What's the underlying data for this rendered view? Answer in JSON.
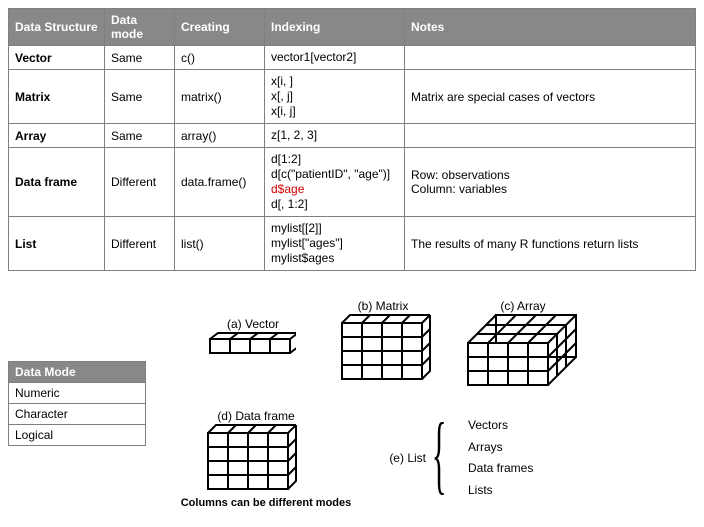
{
  "table": {
    "headers": [
      "Data Structure",
      "Data mode",
      "Creating",
      "Indexing",
      "Notes"
    ],
    "rows": [
      {
        "structure": "Vector",
        "mode": "Same",
        "creating": "c()",
        "indexing": [
          "vector1[vector2]"
        ],
        "notes": ""
      },
      {
        "structure": "Matrix",
        "mode": "Same",
        "creating": "matrix()",
        "indexing": [
          "x[i, ]",
          "x[, j]",
          "x[i, j]"
        ],
        "notes": "Matrix are special cases of vectors"
      },
      {
        "structure": "Array",
        "mode": "Same",
        "creating": "array()",
        "indexing": [
          "z[1, 2, 3]"
        ],
        "notes": ""
      },
      {
        "structure": "Data frame",
        "mode": "Different",
        "creating": "data.frame()",
        "indexing": [
          "d[1:2]",
          "d[c(\"patientID\", \"age\")]",
          "d$age",
          "d[, 1:2]"
        ],
        "red_index": 2,
        "notes": "Row: observations\nColumn: variables"
      },
      {
        "structure": "List",
        "mode": "Different",
        "creating": "list()",
        "indexing": [
          "mylist[[2]]",
          "mylist[\"ages\"]",
          "mylist$ages"
        ],
        "notes": "The results of many R functions return lists"
      }
    ]
  },
  "mode_table": {
    "header": "Data Mode",
    "rows": [
      "Numeric",
      "Character",
      "Logical"
    ]
  },
  "diagrams": {
    "a": "(a) Vector",
    "b": "(b) Matrix",
    "c": "(c) Array",
    "d": "(d) Data frame",
    "e": "(e) List",
    "d_caption": "Columns can be different modes"
  },
  "list_contents": [
    "Vectors",
    "Arrays",
    "Data frames",
    "Lists"
  ]
}
